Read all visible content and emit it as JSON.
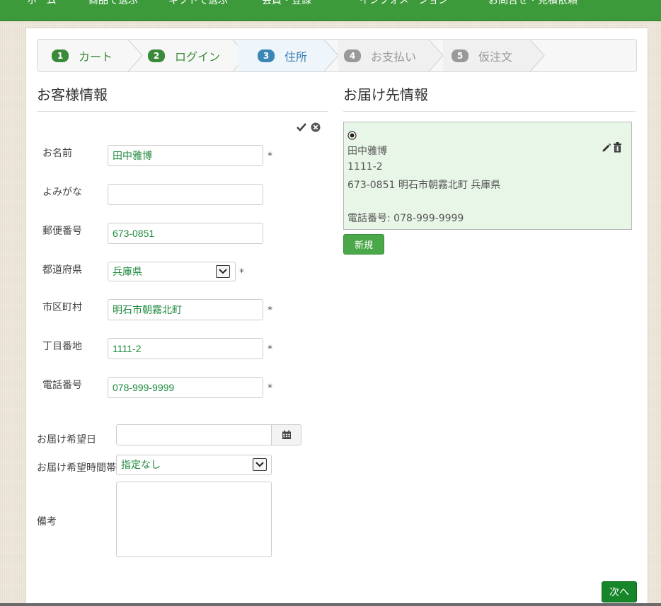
{
  "topnav": {
    "items": [
      "ホーム",
      "商品で選ぶ",
      "ギフトで選ぶ",
      "会員・登録",
      "インフォメーション",
      "お問合せ・見積依頼"
    ]
  },
  "steps": [
    {
      "num": "1",
      "label": "カート",
      "state": "done"
    },
    {
      "num": "2",
      "label": "ログイン",
      "state": "done"
    },
    {
      "num": "3",
      "label": "住所",
      "state": "active"
    },
    {
      "num": "4",
      "label": "お支払い",
      "state": "todo"
    },
    {
      "num": "5",
      "label": "仮注文",
      "state": "todo"
    }
  ],
  "customer": {
    "heading": "お客様情報",
    "required_mark": "*",
    "name": {
      "label": "お名前",
      "value": "田中雅博"
    },
    "kana": {
      "label": "よみがな",
      "value": ""
    },
    "zip": {
      "label": "郵便番号",
      "value": "673-0851"
    },
    "prefecture": {
      "label": "都道府県",
      "value": "兵庫県"
    },
    "city": {
      "label": "市区町村",
      "value": "明石市朝霧北町"
    },
    "street": {
      "label": "丁目番地",
      "value": "1111-2"
    },
    "phone": {
      "label": "電話番号",
      "value": "078-999-9999"
    }
  },
  "delivery_options": {
    "date": {
      "label": "お届け希望日",
      "value": ""
    },
    "time": {
      "label": "お届け希望時間帯",
      "value": "指定なし"
    },
    "notes": {
      "label": "備考",
      "value": ""
    }
  },
  "shipping": {
    "heading": "お届け先情報",
    "address": {
      "name": "田中雅博",
      "street": "1111-2",
      "line": "673-0851 明石市朝霧北町 兵庫県",
      "phone": "電話番号: 078-999-9999"
    },
    "new_button": "新規"
  },
  "next_button": "次へ",
  "colors": {
    "brand_green": "#3c9a3a",
    "active_step": "#3a87b5",
    "card_bg": "#e8f6e8",
    "value_text": "#1f8a3e"
  }
}
